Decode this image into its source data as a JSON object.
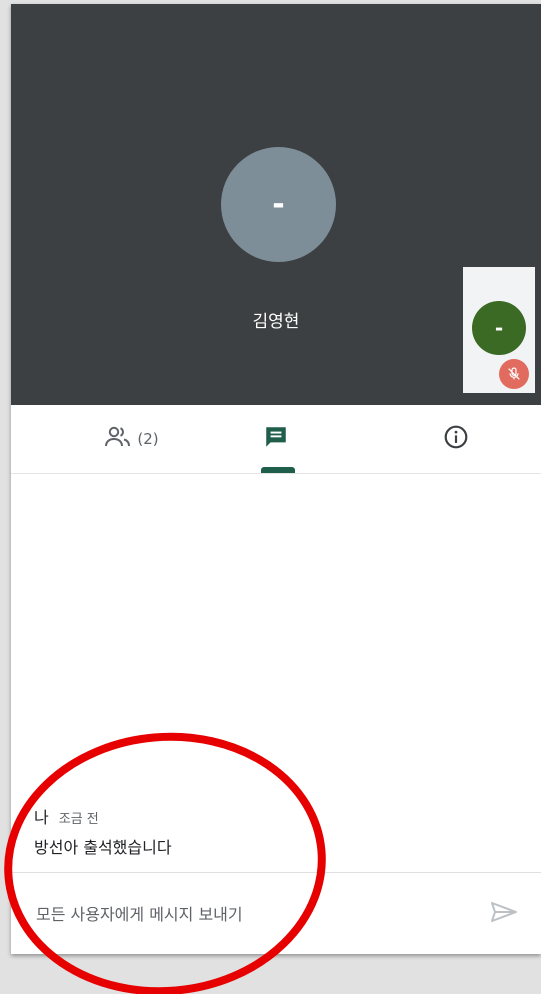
{
  "video": {
    "main_participant": {
      "initial": "-",
      "name": "김영현"
    },
    "self": {
      "initial": "-",
      "mic_state_icon": "mic-off-icon"
    }
  },
  "tabs": {
    "people": {
      "icon": "people-icon",
      "count": "(2)"
    },
    "chat": {
      "icon": "chat-icon",
      "selected": true
    },
    "info": {
      "icon": "info-icon"
    }
  },
  "chat": {
    "messages": [
      {
        "sender": "나",
        "time": "조금 전",
        "text": "방선아 출석했습니다"
      }
    ]
  },
  "composer": {
    "placeholder": "모든 사용자에게 메시지 보내기",
    "send_icon": "send-icon"
  },
  "colors": {
    "video_bg": "#3c4043",
    "main_avatar": "#7e8e99",
    "self_avatar": "#3a6a24",
    "mic_off": "#e26b60",
    "accent": "#1e5e4a",
    "annotation": "#e60000"
  }
}
